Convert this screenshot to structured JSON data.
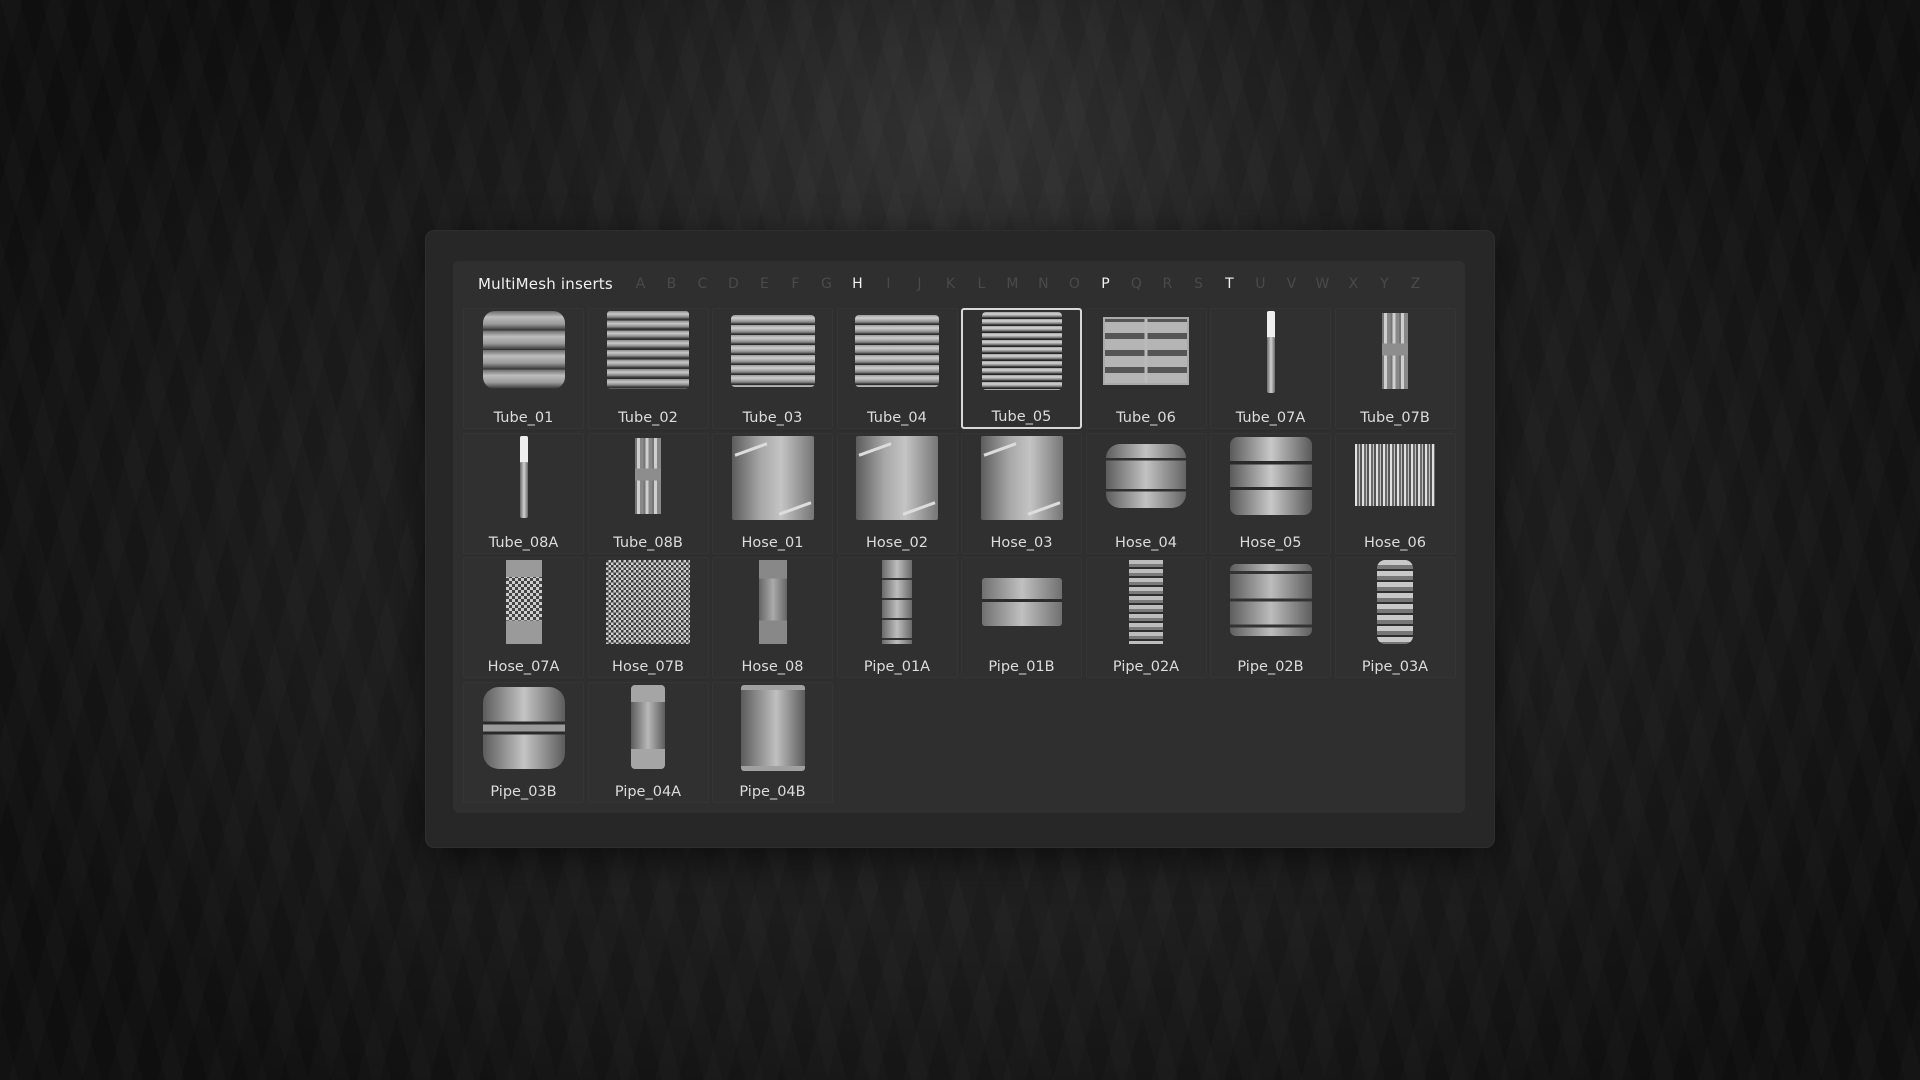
{
  "panel": {
    "title": "MultiMesh inserts",
    "alphabet": [
      {
        "letter": "A",
        "active": false
      },
      {
        "letter": "B",
        "active": false
      },
      {
        "letter": "C",
        "active": false
      },
      {
        "letter": "D",
        "active": false
      },
      {
        "letter": "E",
        "active": false
      },
      {
        "letter": "F",
        "active": false
      },
      {
        "letter": "G",
        "active": false
      },
      {
        "letter": "H",
        "active": true
      },
      {
        "letter": "I",
        "active": false
      },
      {
        "letter": "J",
        "active": false
      },
      {
        "letter": "K",
        "active": false
      },
      {
        "letter": "L",
        "active": false
      },
      {
        "letter": "M",
        "active": false
      },
      {
        "letter": "N",
        "active": false
      },
      {
        "letter": "O",
        "active": false
      },
      {
        "letter": "P",
        "active": true
      },
      {
        "letter": "Q",
        "active": false
      },
      {
        "letter": "R",
        "active": false
      },
      {
        "letter": "S",
        "active": false
      },
      {
        "letter": "T",
        "active": true
      },
      {
        "letter": "U",
        "active": false
      },
      {
        "letter": "V",
        "active": false
      },
      {
        "letter": "W",
        "active": false
      },
      {
        "letter": "X",
        "active": false
      },
      {
        "letter": "Y",
        "active": false
      },
      {
        "letter": "Z",
        "active": false
      }
    ],
    "selected_item": "Tube_05",
    "items": [
      {
        "label": "Tube_01",
        "thumb": "ribbed-fat"
      },
      {
        "label": "Tube_02",
        "thumb": "ribbed-thin"
      },
      {
        "label": "Tube_03",
        "thumb": "ribbed-mid"
      },
      {
        "label": "Tube_04",
        "thumb": "ribbed-mid"
      },
      {
        "label": "Tube_05",
        "thumb": "ribbed-tight"
      },
      {
        "label": "Tube_06",
        "thumb": "crate"
      },
      {
        "label": "Tube_07A",
        "thumb": "rod"
      },
      {
        "label": "Tube_07B",
        "thumb": "rod-double"
      },
      {
        "label": "Tube_08A",
        "thumb": "rod"
      },
      {
        "label": "Tube_08B",
        "thumb": "rod-double"
      },
      {
        "label": "Hose_01",
        "thumb": "barrel"
      },
      {
        "label": "Hose_02",
        "thumb": "barrel"
      },
      {
        "label": "Hose_03",
        "thumb": "barrel"
      },
      {
        "label": "Hose_04",
        "thumb": "bulge"
      },
      {
        "label": "Hose_05",
        "thumb": "stack3"
      },
      {
        "label": "Hose_06",
        "thumb": "stripes"
      },
      {
        "label": "Hose_07A",
        "thumb": "hose-mesh"
      },
      {
        "label": "Hose_07B",
        "thumb": "mesh-wide"
      },
      {
        "label": "Hose_08",
        "thumb": "column"
      },
      {
        "label": "Pipe_01A",
        "thumb": "pipe-narrow"
      },
      {
        "label": "Pipe_01B",
        "thumb": "pipe-flat"
      },
      {
        "label": "Pipe_02A",
        "thumb": "pipe-rings"
      },
      {
        "label": "Pipe_02B",
        "thumb": "pipe-drum"
      },
      {
        "label": "Pipe_03A",
        "thumb": "pipe-beads"
      },
      {
        "label": "Pipe_03B",
        "thumb": "pipe-bulge2"
      },
      {
        "label": "Pipe_04A",
        "thumb": "pipe-spool"
      },
      {
        "label": "Pipe_04B",
        "thumb": "pipe-spool-wide"
      }
    ]
  }
}
